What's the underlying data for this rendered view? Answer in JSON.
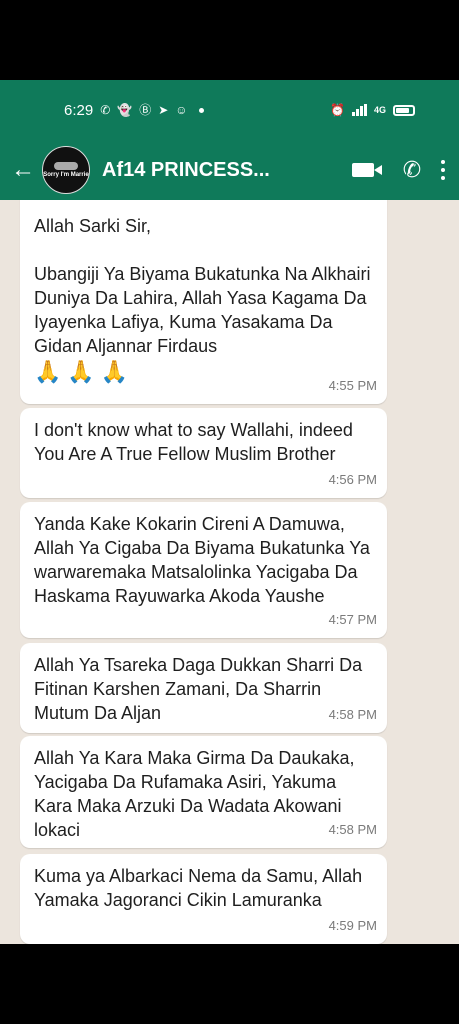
{
  "status_bar": {
    "time": "6:29",
    "icons_left": [
      "whatsapp-icon",
      "snapchat-icon",
      "b-app-icon",
      "telegram-icon",
      "bot-icon"
    ],
    "icons_right": [
      "alarm-icon",
      "signal-icon",
      "4g-signal-icon",
      "battery-icon"
    ],
    "network_label": "4G"
  },
  "header": {
    "contact_name": "Af14 PRINCESS...",
    "avatar_text": "Sorry I'm Marrie"
  },
  "messages": [
    {
      "text": "Allah Sarki Sir,\n\nUbangiji Ya Biyama Bukatunka Na Alkhairi Duniya Da Lahira, Allah Yasa Kagama Da Iyayenka Lafiya, Kuma Yasakama Da Gidan Aljannar Firdaus",
      "emoji": [
        "🙏",
        "🙏",
        "🙏"
      ],
      "time": "4:55 PM"
    },
    {
      "text": "I don't know what to say Wallahi, indeed You Are A True Fellow Muslim Brother",
      "time": "4:56 PM"
    },
    {
      "text": "Yanda Kake Kokarin Cireni A Damuwa, Allah Ya Cigaba Da Biyama Bukatunka Ya warwaremaka Matsalolinka Yacigaba Da Haskama Rayuwarka Akoda Yaushe",
      "time": "4:57 PM"
    },
    {
      "text": "Allah Ya Tsareka Daga Dukkan Sharri Da Fitinan Karshen Zamani, Da Sharrin Mutum Da Aljan",
      "time": "4:58 PM"
    },
    {
      "text": "Allah Ya Kara Maka Girma Da Daukaka, Yacigaba Da Rufamaka Asiri, Yakuma Kara Maka Arzuki Da Wadata Akowani lokaci",
      "time": "4:58 PM"
    },
    {
      "text": "Kuma ya Albarkaci Nema da Samu, Allah Yamaka Jagoranci Cikin Lamuranka",
      "time": "4:59 PM"
    }
  ],
  "colors": {
    "header_green": "#0f7a5a",
    "chat_background": "#ece5dd",
    "bubble": "#ffffff",
    "timestamp": "#7a7a7a"
  }
}
